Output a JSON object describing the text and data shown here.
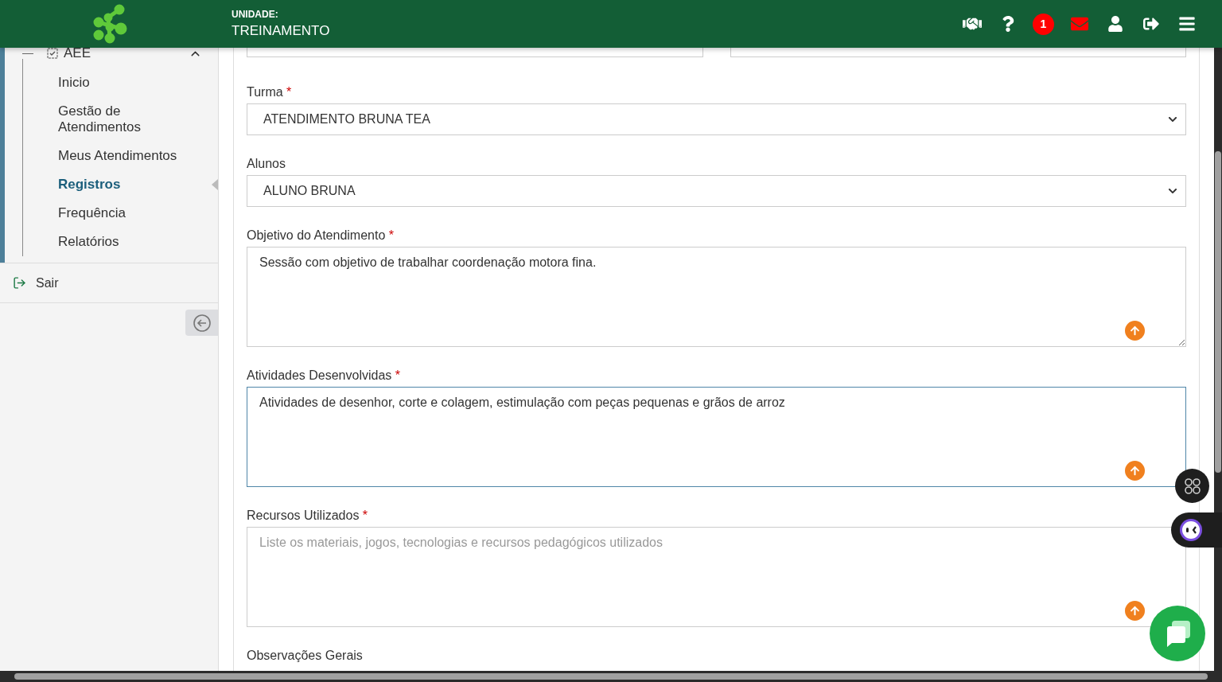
{
  "header": {
    "unit_label": "UNIDADE:",
    "unit_name": "TREINAMENTO",
    "notification_count": "1"
  },
  "sidebar": {
    "section": {
      "label": "AEE",
      "expanded": true
    },
    "items": [
      {
        "label": "Inicio",
        "selected": false
      },
      {
        "label": "Gestão de Atendimentos",
        "selected": false
      },
      {
        "label": "Meus Atendimentos",
        "selected": false
      },
      {
        "label": "Registros",
        "selected": true
      },
      {
        "label": "Frequência",
        "selected": false
      },
      {
        "label": "Relatórios",
        "selected": false
      }
    ],
    "logout": "Sair"
  },
  "form": {
    "fields": [
      {
        "kind": "select",
        "label": "Turma",
        "required_mark": "*",
        "value": "ATENDIMENTO BRUNA TEA"
      },
      {
        "kind": "select",
        "label": "Alunos",
        "value": "ALUNO BRUNA"
      },
      {
        "kind": "textarea",
        "label": "Objetivo do Atendimento",
        "required_mark": "*",
        "value": "Sessão com objetivo de trabalhar coordenação motora fina.",
        "focused": false
      },
      {
        "kind": "textarea",
        "label": "Atividades Desenvolvidas",
        "required_mark": "*",
        "value": "Atividades de desenhor, corte e colagem, estimulação com peças pequenas e grãos de arroz",
        "focused": true
      },
      {
        "kind": "textarea",
        "label": "Recursos Utilizados",
        "required_mark": "*",
        "placeholder": "Liste os materiais, jogos, tecnologias e recursos pedagógicos utilizados",
        "focused": false
      },
      {
        "kind": "heading",
        "label": "Observações Gerais"
      }
    ]
  }
}
